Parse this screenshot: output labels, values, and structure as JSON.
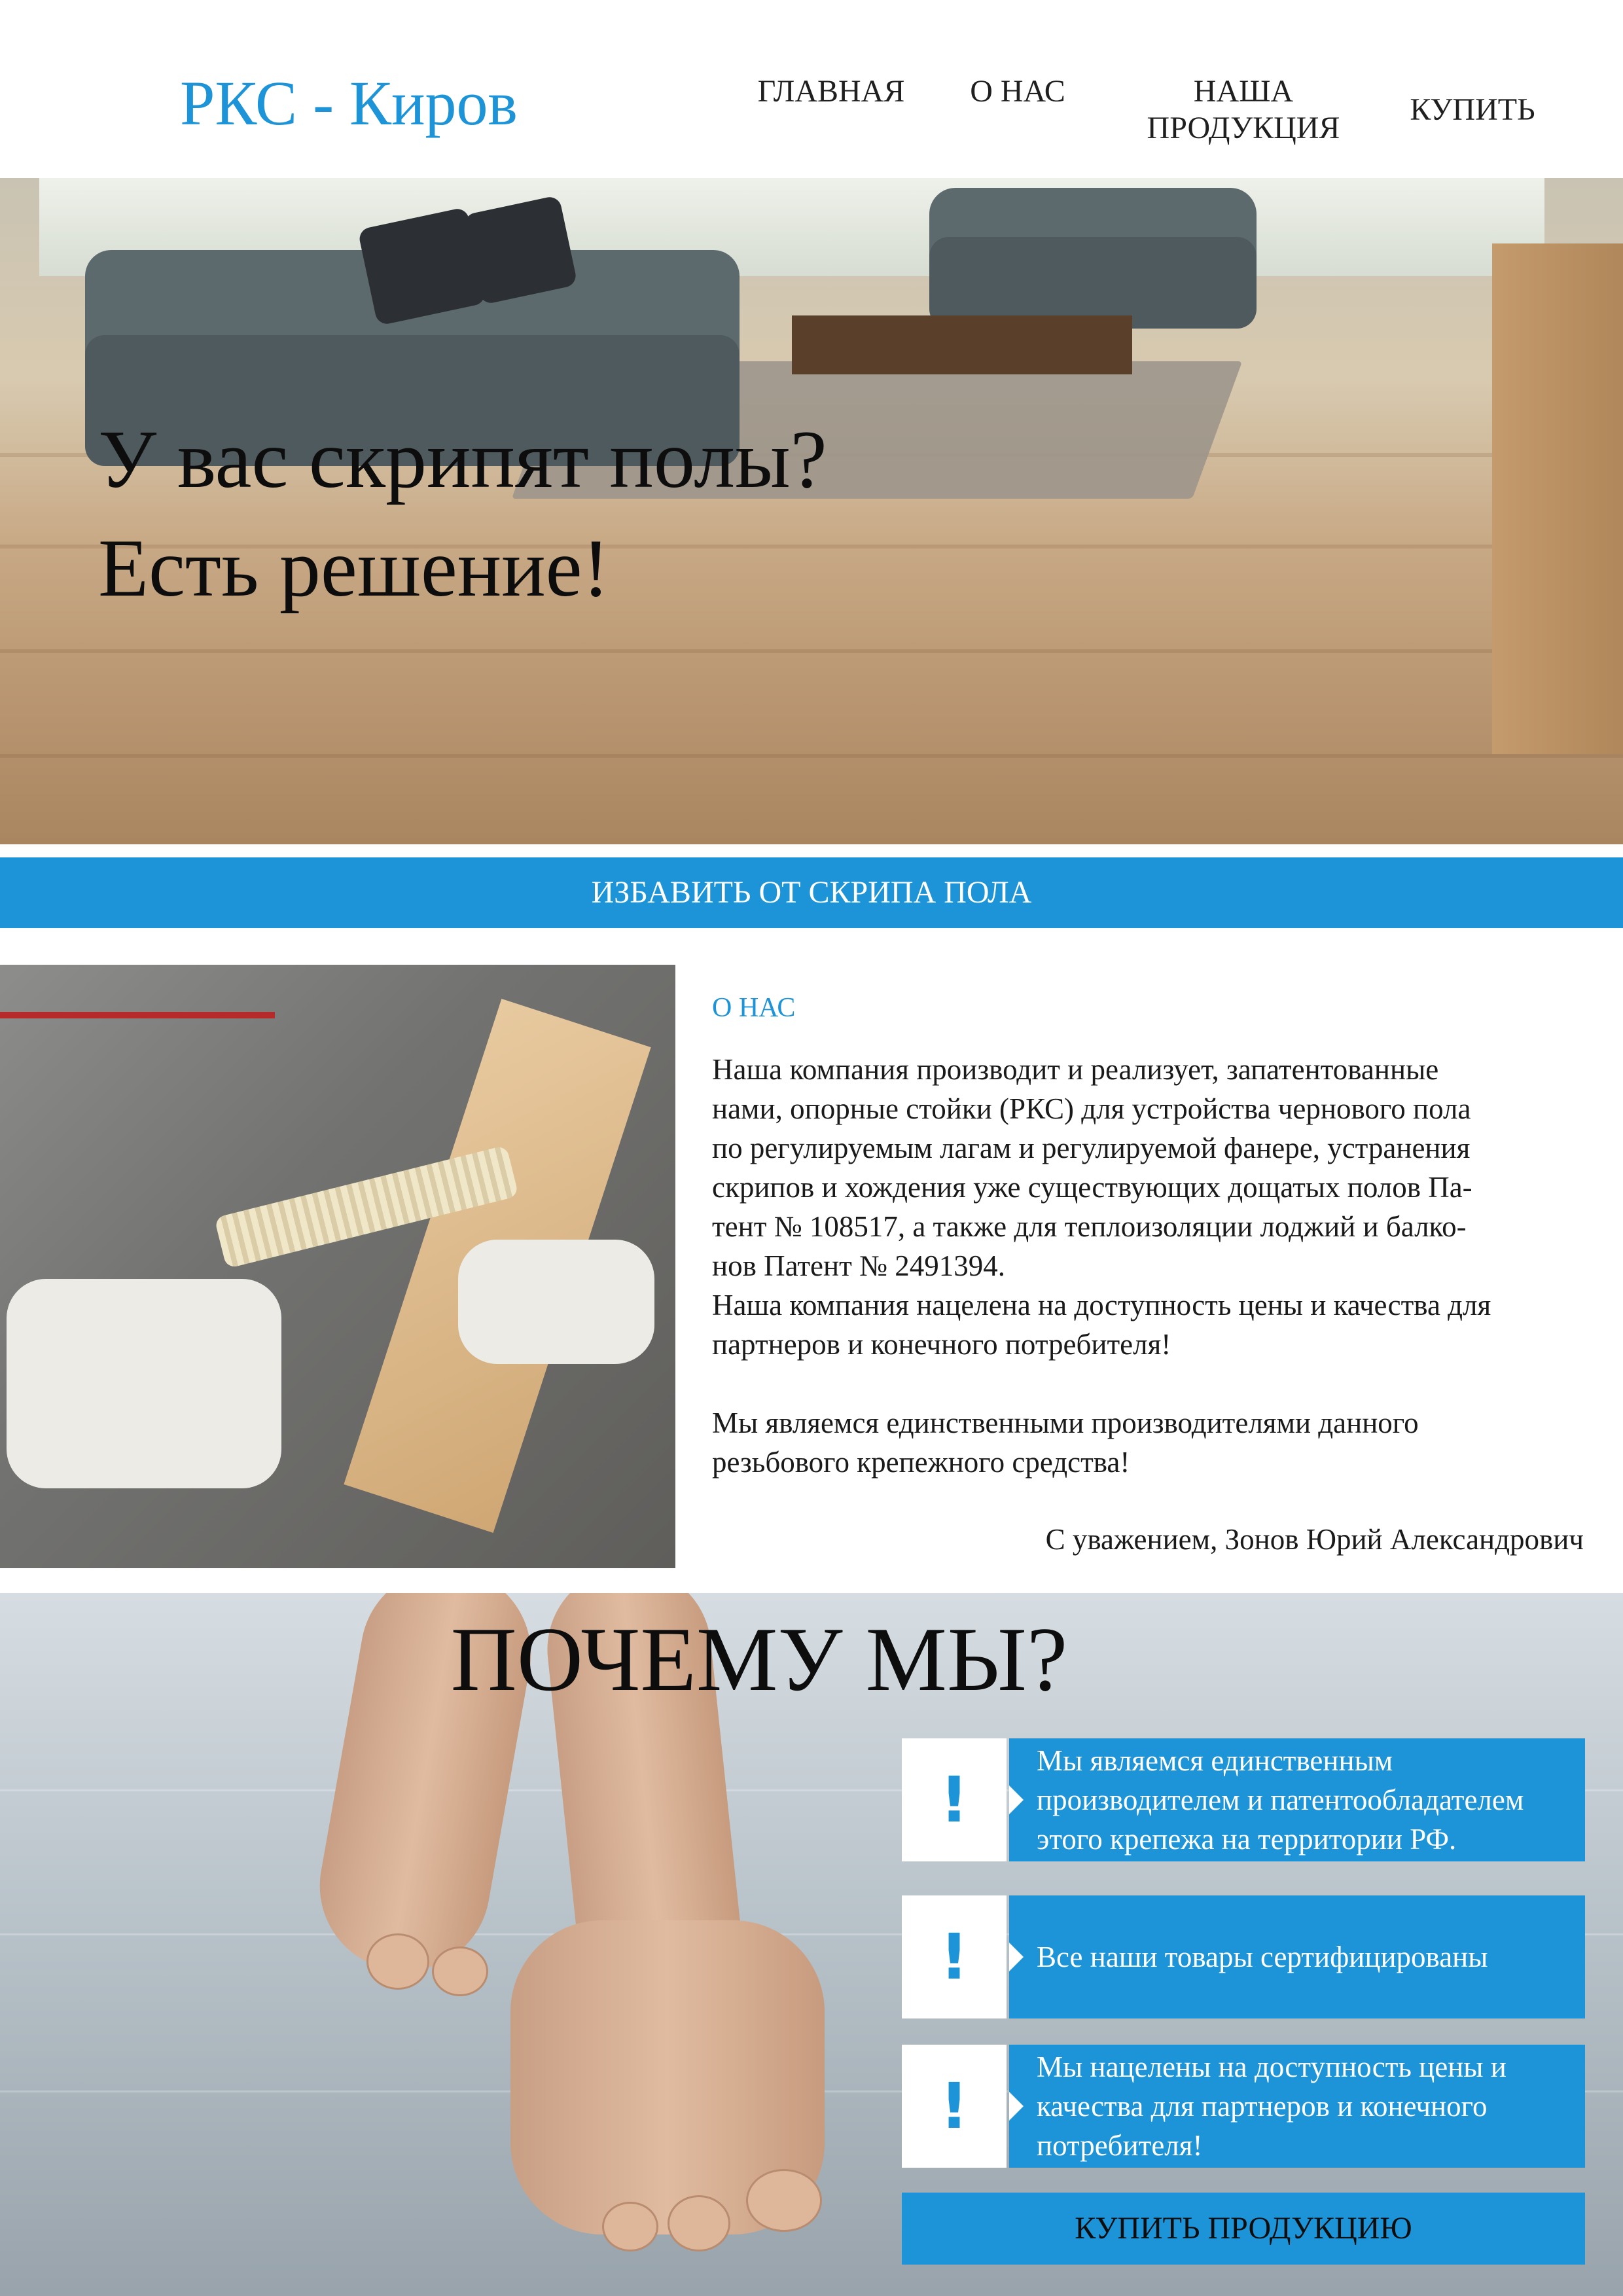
{
  "header": {
    "logo": "РКС - Киров",
    "nav": [
      {
        "label": "ГЛАВНАЯ"
      },
      {
        "label": "О НАС"
      },
      {
        "label": "НАША\nПРОДУКЦИЯ"
      },
      {
        "label": "КУПИТЬ"
      }
    ]
  },
  "hero": {
    "title": "У вас скрипят полы?\nЕсть решение!"
  },
  "cta": {
    "label": "ИЗБАВИТЬ ОТ СКРИПА ПОЛА"
  },
  "about": {
    "heading": "О НАС",
    "body": "Наша компания производит и реализует, запатентованные\nнами, опорные стойки (РКС)  для устройства чернового пола\nпо регулируемым лагам и регулируемой фанере, устранения\nскрипов и хождения уже существующих дощатых полов  Па-\nтент  № 108517, а также для теплоизоляции лоджий и балко-\nнов Патент № 2491394.\nНаша компания нацелена на доступность цены и качества для\nпартнеров и конечного потребителя!\n\nМы являемся единственными производителями данного\nрезьбового крепежного средства!",
    "signature": "С уважением, Зонов Юрий Александрович"
  },
  "why": {
    "title": "ПОЧЕМУ МЫ?",
    "features": [
      {
        "icon": "exclamation-icon",
        "text": "Мы являемся единственным производителем и патентообладателем этого крепежа на территории РФ."
      },
      {
        "icon": "exclamation-icon",
        "text": "Все наши товары сертифицированы"
      },
      {
        "icon": "exclamation-icon",
        "text": "Мы нацелены на доступность цены и качества для партнеров и конечного потребителя!"
      }
    ],
    "buy_button": "КУПИТЬ ПРОДУКЦИЮ"
  },
  "colors": {
    "accent": "#1d93d8",
    "text": "#1a1a1a",
    "background": "#ffffff"
  }
}
